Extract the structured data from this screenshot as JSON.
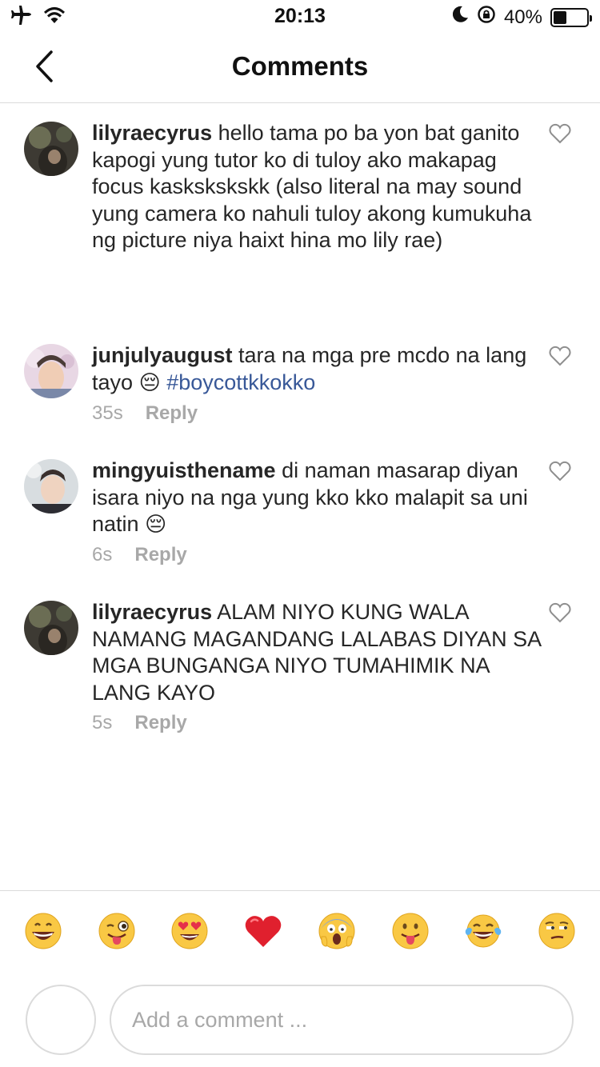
{
  "status_bar": {
    "time": "20:13",
    "battery_text": "40%",
    "battery_level": 0.4,
    "icons": [
      "airplane-icon",
      "wifi-icon",
      "moon-icon",
      "rotation-lock-icon",
      "battery-icon"
    ]
  },
  "header": {
    "title": "Comments",
    "back_icon": "chevron-left-icon"
  },
  "comments": [
    {
      "username": "lilyraecyrus",
      "text": "hello tama po ba yon bat ganito kapogi yung tutor ko di tuloy ako makapag focus kaskskskskk (also literal na may sound yung camera ko nahuli tuloy akong kumukuha ng picture niya haixt hina mo lily rae)",
      "time": "",
      "reply_label": ""
    },
    {
      "username": "junjulyaugust",
      "text": "tara na mga pre mcdo na lang tayo",
      "emoji": "😔",
      "hashtag": "#boycottkkokko",
      "time": "35s",
      "reply_label": "Reply"
    },
    {
      "username": "mingyuisthename",
      "text": "di naman masarap diyan isara niyo na nga yung kko kko malapit sa uni natin",
      "emoji": "😔",
      "time": "6s",
      "reply_label": "Reply"
    },
    {
      "username": "lilyraecyrus",
      "text": "ALAM NIYO KUNG WALA NAMANG MAGANDANG LALABAS DIYAN SA MGA BUNGANGA NIYO TUMAHIMIK NA LANG KAYO",
      "time": "5s",
      "reply_label": "Reply"
    }
  ],
  "emoji_bar": [
    "😄",
    "😜",
    "😍",
    "❤️",
    "😱",
    "😛",
    "😂",
    "😒"
  ],
  "composer": {
    "placeholder": "Add a comment ..."
  },
  "colors": {
    "hashtag": "#385898",
    "muted": "#a8a8a8",
    "divider": "#dbdbdb",
    "text": "#262626"
  }
}
